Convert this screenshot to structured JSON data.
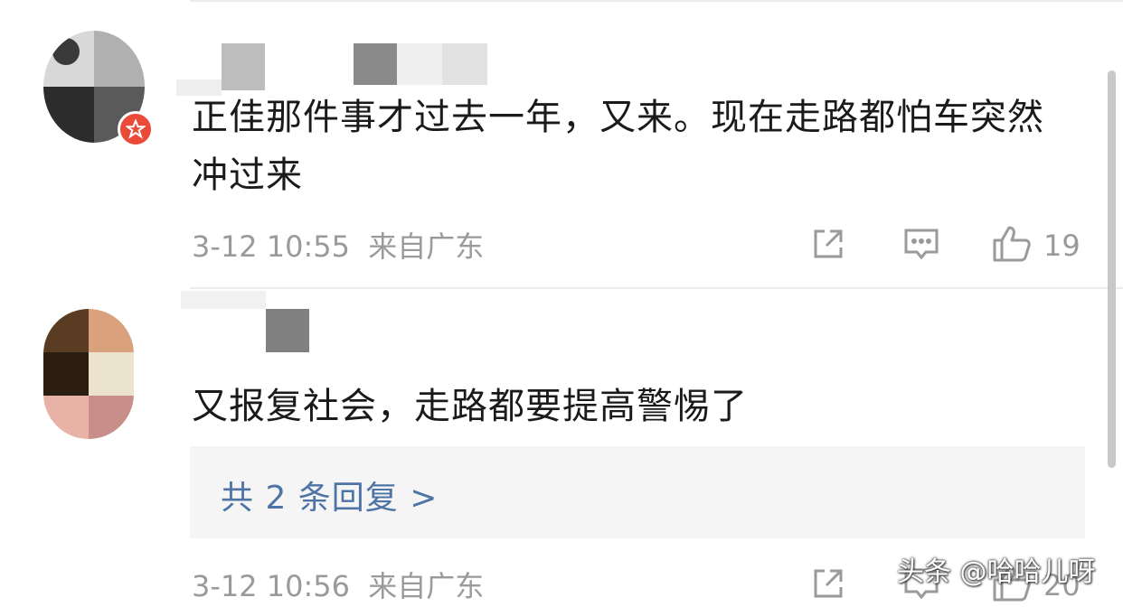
{
  "comments": [
    {
      "text": "正佳那件事才过去一年，又来。现在走路都怕车突然冲过来",
      "time": "3-12 10:55",
      "location": "来自广东",
      "likes": "19",
      "icons": [
        "share-icon",
        "comment-icon",
        "like-icon"
      ]
    },
    {
      "text": "又报复社会，走路都要提高警惕了",
      "reply_link": "共 2 条回复 >",
      "time": "3-12 10:56",
      "location": "来自广东",
      "likes": "20",
      "icons": [
        "share-icon",
        "comment-icon",
        "like-icon"
      ]
    }
  ],
  "watermark": "头条 @哈哈儿呀",
  "colors": {
    "text": "#1a1a1a",
    "meta": "#9a9a9a",
    "link": "#4e73a5",
    "badge": "#ea4a38",
    "reply_bg": "#f5f5f5"
  }
}
